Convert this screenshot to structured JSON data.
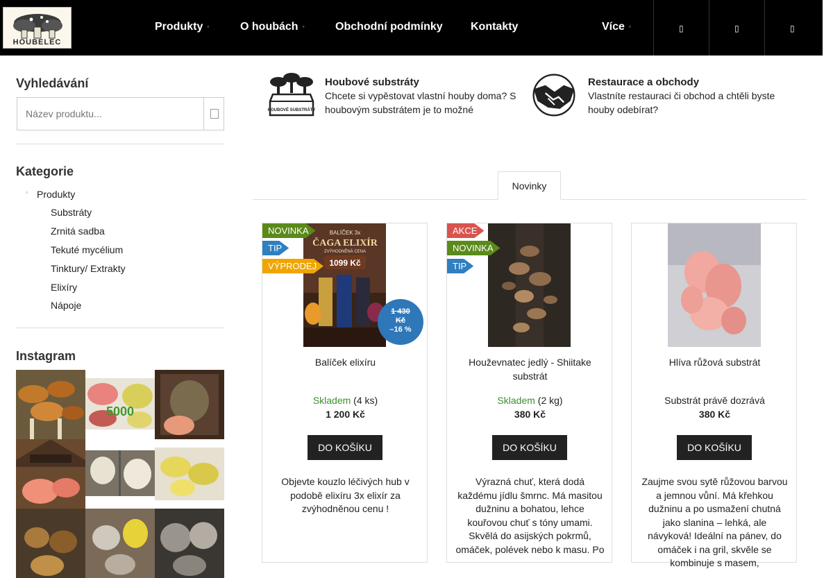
{
  "header": {
    "logo_text": "HOUBELEC",
    "nav": [
      {
        "label": "Produkty",
        "has_dropdown": true
      },
      {
        "label": "O houbách",
        "has_dropdown": true
      },
      {
        "label": "Obchodní podmínky",
        "has_dropdown": false
      },
      {
        "label": "Kontakty",
        "has_dropdown": false
      },
      {
        "label": "Více",
        "has_dropdown": true
      }
    ],
    "icons": [
      "search-icon",
      "user-icon",
      "cart-icon"
    ]
  },
  "sidebar": {
    "search_title": "Vyhledávání",
    "search_placeholder": "Název produktu...",
    "categories_title": "Kategorie",
    "categories": {
      "root": "Produkty",
      "children": [
        "Substráty",
        "Zrnitá sadba",
        "Tekuté mycélium",
        "Tinktury/ Extrakty",
        "Elixíry",
        "Nápoje"
      ]
    },
    "instagram_title": "Instagram",
    "instagram_badge": "5000"
  },
  "features": [
    {
      "title": "Houbové substráty",
      "text": "Chcete si vypěstovat vlastní houby doma? S houbovým substrátem je to možné",
      "icon": "substrate-box-icon",
      "icon_label": "HOUBOVÉ SUBSTRÁTY"
    },
    {
      "title": "Restaurace a obchody",
      "text": "Vlastníte restauraci či obchod a chtěli byste houby odebírat?",
      "icon": "handshake-icon"
    }
  ],
  "tabs": [
    "Novinky"
  ],
  "colors": {
    "header_bg": "#000000",
    "flag_new": "#5a8a1a",
    "flag_tip": "#2f7fc1",
    "flag_sale": "#f0a500",
    "flag_action": "#d9534f",
    "discount_badge": "#2e77b8",
    "stock_ok": "#3d8f2e",
    "button_bg": "#222222"
  },
  "products": [
    {
      "flags": [
        "NOVINKA",
        "TIP",
        "VÝPRODEJ"
      ],
      "image_text": {
        "line1": "BALÍČEK 3x",
        "line2": "ČAGA ELIXÍR",
        "line3": "ZVÝHODNĚNÁ CENA",
        "price": "1099 Kč"
      },
      "discount": {
        "old_price": "1 430",
        "old_currency": "Kč",
        "percent": "–16 %"
      },
      "name": "Balíček elixíru",
      "stock_label": "Skladem",
      "stock_qty": "(4 ks)",
      "price": "1 200 Kč",
      "button": "DO KOŠÍKU",
      "description": "Objevte kouzlo léčivých hub v podobě elixíru  3x elixír  za zvýhodněnou cenu !"
    },
    {
      "flags": [
        "AKCE",
        "NOVINKA",
        "TIP"
      ],
      "name": "Houževnatec jedlý - Shiitake substrát",
      "stock_label": "Skladem",
      "stock_qty": "(2 kg)",
      "price": "380 Kč",
      "button": "DO KOŠÍKU",
      "description": "Výrazná chuť, která dodá každému jídlu šmrnc. Má masitou dužninu a bohatou, lehce kouřovou chuť s tóny umami. Skvělá do asijských pokrmů, omáček, polévek nebo k masu. Po"
    },
    {
      "flags": [],
      "name": "Hlíva růžová substrát",
      "stock_label": "",
      "stock_qty": "Substrát právě dozrává",
      "price": "380 Kč",
      "button": "DO KOŠÍKU",
      "description": "Zaujme svou sytě růžovou barvou a jemnou vůní. Má křehkou dužninu a po usmažení chutná jako slanina – lehká, ale návyková! Ideální na pánev, do omáček i na gril, skvěle se kombinuje s masem,"
    }
  ]
}
